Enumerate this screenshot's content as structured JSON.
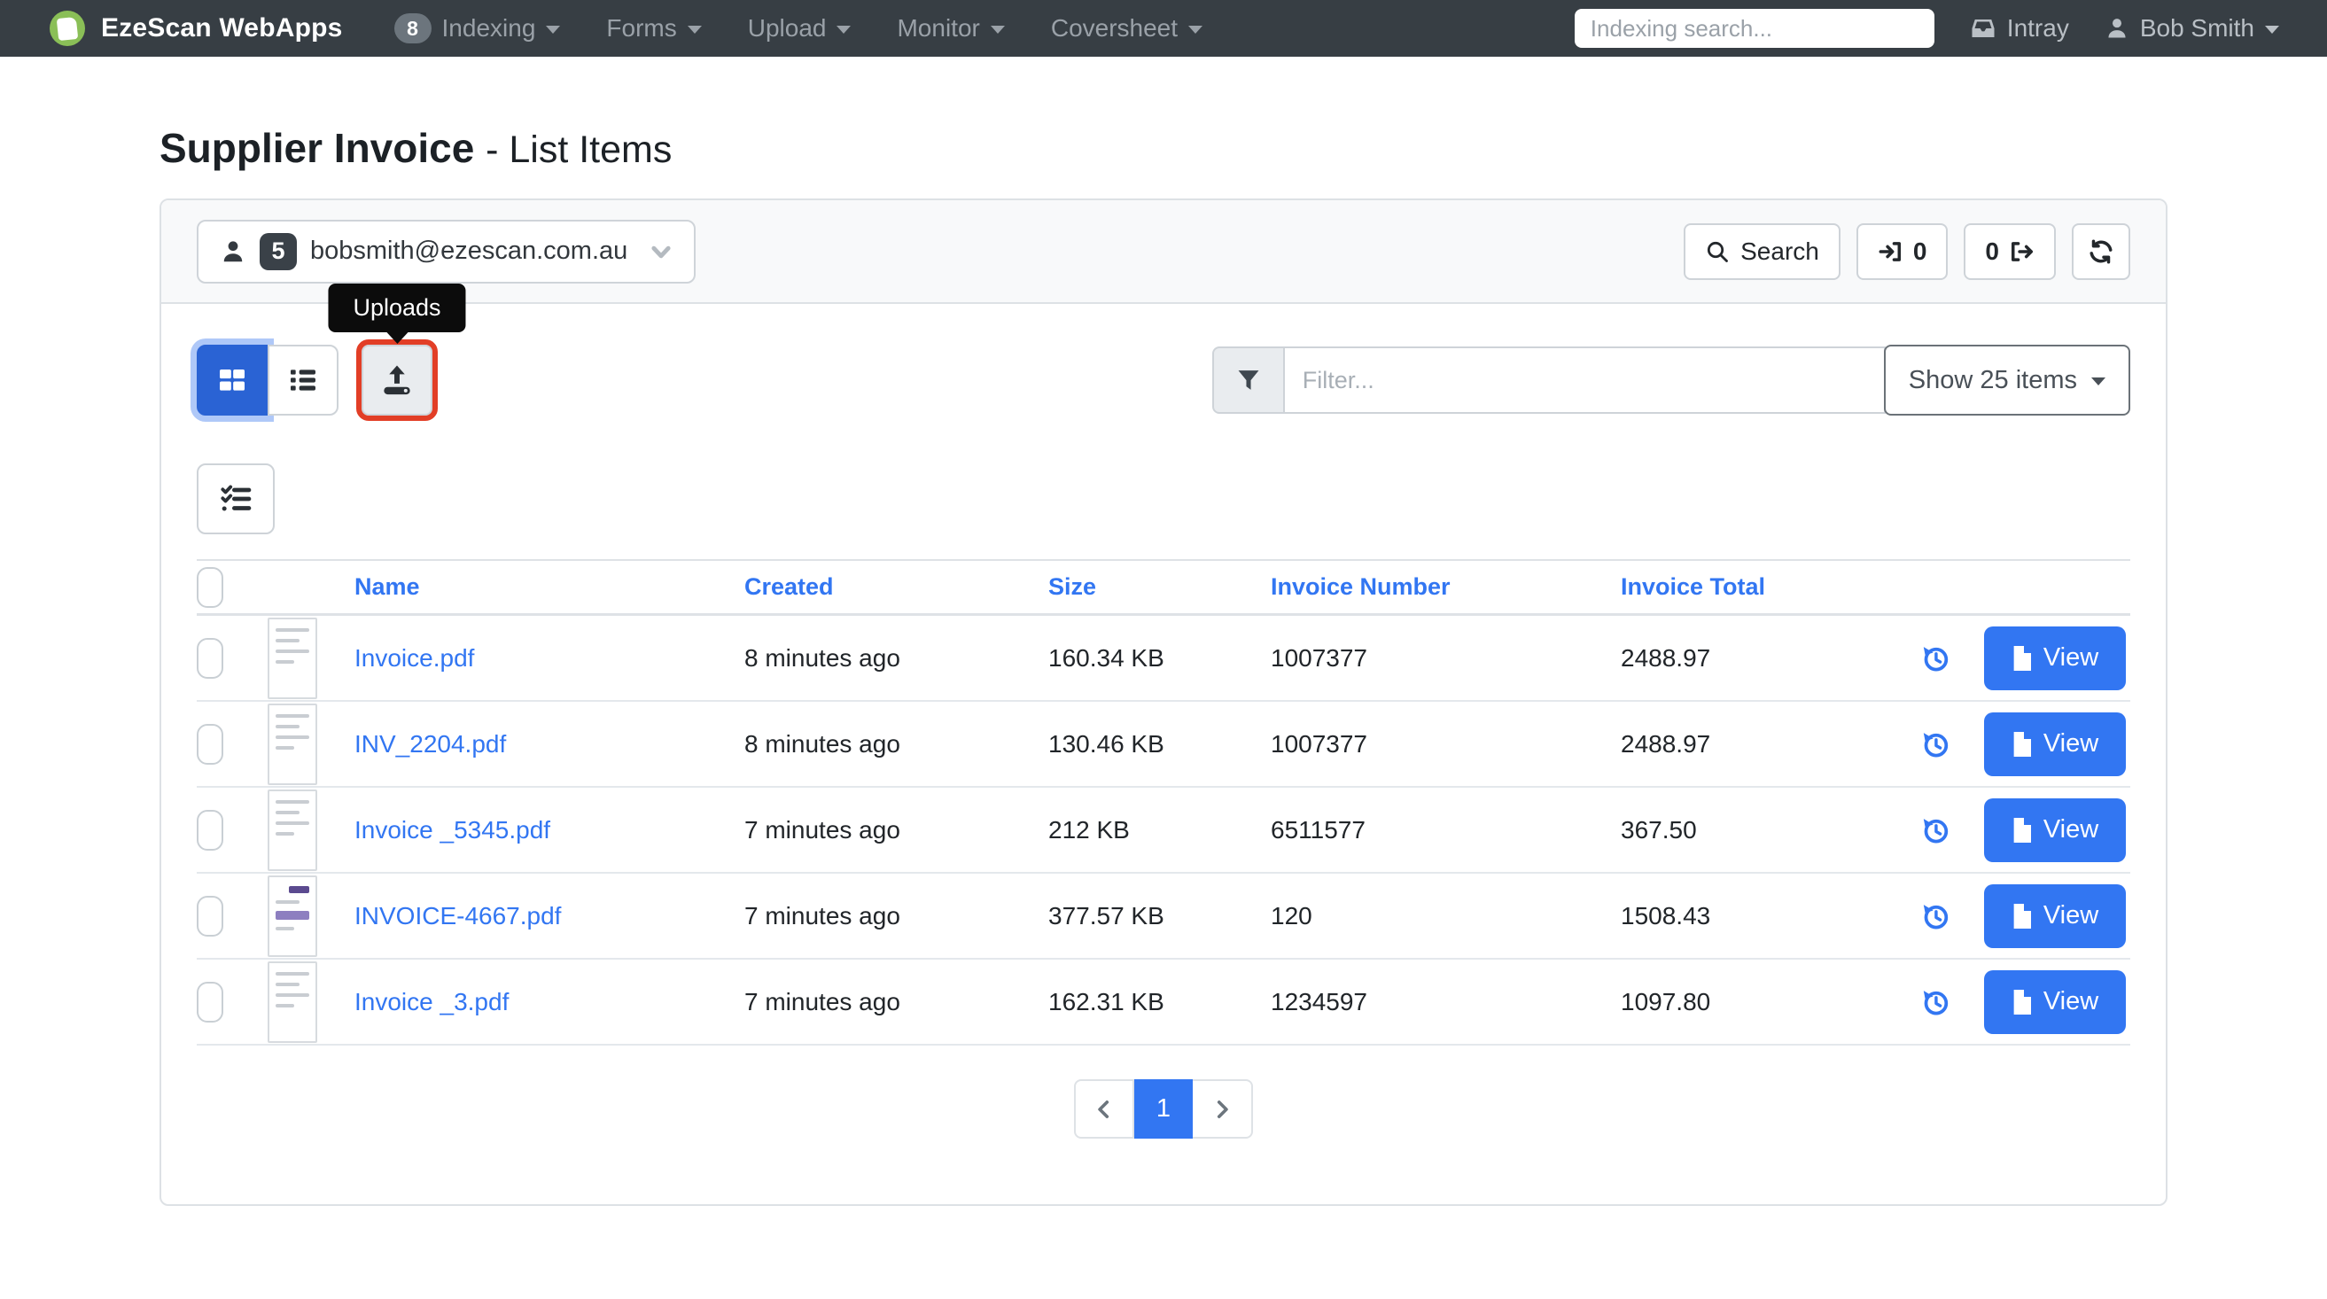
{
  "navbar": {
    "brand": "EzeScan WebApps",
    "items": [
      {
        "label": "Indexing",
        "badge": "8"
      },
      {
        "label": "Forms"
      },
      {
        "label": "Upload"
      },
      {
        "label": "Monitor"
      },
      {
        "label": "Coversheet"
      }
    ],
    "search_placeholder": "Indexing search...",
    "intray_label": "Intray",
    "user_name": "Bob Smith"
  },
  "page": {
    "title": "Supplier Invoice",
    "subtitle": "- List Items"
  },
  "header_bar": {
    "account_email": "bobsmith@ezescan.com.au",
    "account_badge": "5",
    "search_label": "Search",
    "checkin_count": "0",
    "checkout_count": "0"
  },
  "controls": {
    "uploads_tooltip": "Uploads",
    "filter_placeholder": "Filter...",
    "show_items_label": "Show 25 items"
  },
  "table": {
    "headers": {
      "name": "Name",
      "created": "Created",
      "size": "Size",
      "invoice_number": "Invoice Number",
      "invoice_total": "Invoice Total"
    },
    "view_label": "View",
    "rows": [
      {
        "name": "Invoice.pdf",
        "created": "8 minutes ago",
        "size": "160.34 KB",
        "invoice_number": "1007377",
        "invoice_total": "2488.97",
        "thumb": "doc-a"
      },
      {
        "name": "INV_2204.pdf",
        "created": "8 minutes ago",
        "size": "130.46 KB",
        "invoice_number": "1007377",
        "invoice_total": "2488.97",
        "thumb": "doc-a"
      },
      {
        "name": "Invoice _5345.pdf",
        "created": "7 minutes ago",
        "size": "212 KB",
        "invoice_number": "6511577",
        "invoice_total": "367.50",
        "thumb": "doc-b"
      },
      {
        "name": "INVOICE-4667.pdf",
        "created": "7 minutes ago",
        "size": "377.57 KB",
        "invoice_number": "120",
        "invoice_total": "1508.43",
        "thumb": "doc-purple"
      },
      {
        "name": "Invoice _3.pdf",
        "created": "7 minutes ago",
        "size": "162.31 KB",
        "invoice_number": "1234597",
        "invoice_total": "1097.80",
        "thumb": "doc-c"
      }
    ]
  },
  "pagination": {
    "current_page": "1"
  },
  "colors": {
    "primary_blue": "#3276f2",
    "active_view_blue": "#2a63d4",
    "navbar_dark": "#373e44",
    "annotation_red": "#e23e26",
    "tooltip_black": "#0c0c0c",
    "header_gray": "#f8f9fa"
  }
}
